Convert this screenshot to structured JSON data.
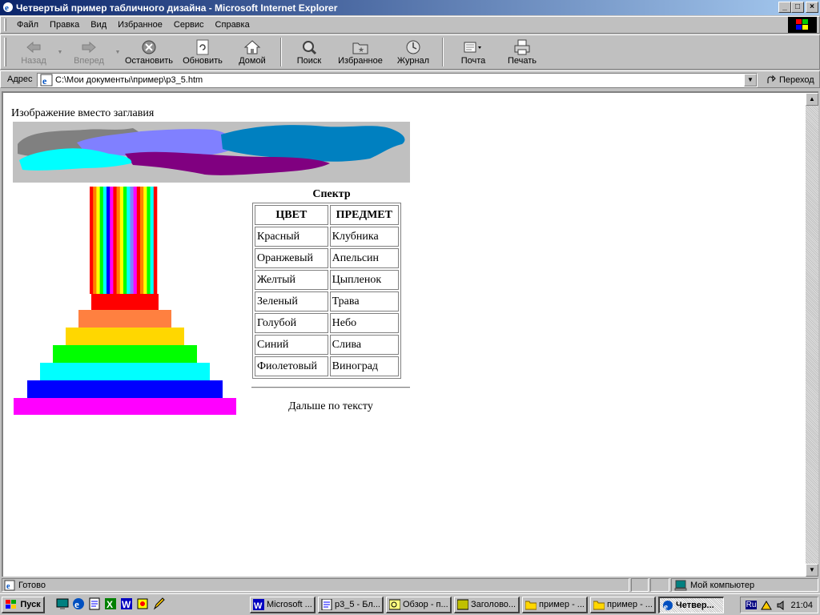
{
  "window": {
    "title": "Четвертый пример табличного дизайна - Microsoft Internet Explorer",
    "controls": {
      "minimize": "_",
      "maximize": "□",
      "close": "×"
    }
  },
  "menu": [
    "Файл",
    "Правка",
    "Вид",
    "Избранное",
    "Сервис",
    "Справка"
  ],
  "toolbar": {
    "back": "Назад",
    "forward": "Вперед",
    "stop": "Остановить",
    "refresh": "Обновить",
    "home": "Домой",
    "search": "Поиск",
    "favorites": "Избранное",
    "history": "Журнал",
    "mail": "Почта",
    "print": "Печать"
  },
  "address": {
    "label": "Адрес",
    "value": "C:\\Мои документы\\пример\\p3_5.htm",
    "go": "Переход"
  },
  "page": {
    "caption": "Изображение вместо заглавия",
    "spectrum_title": "Спектр",
    "table_headers": [
      "ЦВЕТ",
      "ПРЕДМЕТ"
    ],
    "table_rows": [
      [
        "Красный",
        "Клубника"
      ],
      [
        "Оранжевый",
        "Апельсин"
      ],
      [
        "Желтый",
        "Цыпленок"
      ],
      [
        "Зеленый",
        "Трава"
      ],
      [
        "Голубой",
        "Небо"
      ],
      [
        "Синий",
        "Слива"
      ],
      [
        "Фиолетовый",
        "Виноград"
      ]
    ],
    "after_text": "Дальше по тексту",
    "rainbow_colors": [
      "#ff0000",
      "#ff8040",
      "#ffd700",
      "#00ff00",
      "#00ffff",
      "#0000ff",
      "#ff00ff"
    ],
    "stripe_colors": [
      "#ff0000",
      "#ff8000",
      "#ffff00",
      "#00ff00",
      "#00ffff",
      "#0000ff",
      "#ff00ff",
      "#ff0000",
      "#ff8000",
      "#ffff00",
      "#00ff00",
      "#00ffff",
      "#8080ff",
      "#ff00ff",
      "#ff0000",
      "#ff8000",
      "#ffff00",
      "#00ff00",
      "#00ffff",
      "#ff0000"
    ]
  },
  "status": {
    "text": "Готово",
    "zone": "Мой компьютер"
  },
  "taskbar": {
    "start": "Пуск",
    "tasks": [
      "Microsoft ...",
      "p3_5 - Бл...",
      "Обзор - п...",
      "Заголово...",
      "пример - ...",
      "пример - ...",
      "Четвер..."
    ],
    "lang": "Ru",
    "clock": "21:04"
  }
}
